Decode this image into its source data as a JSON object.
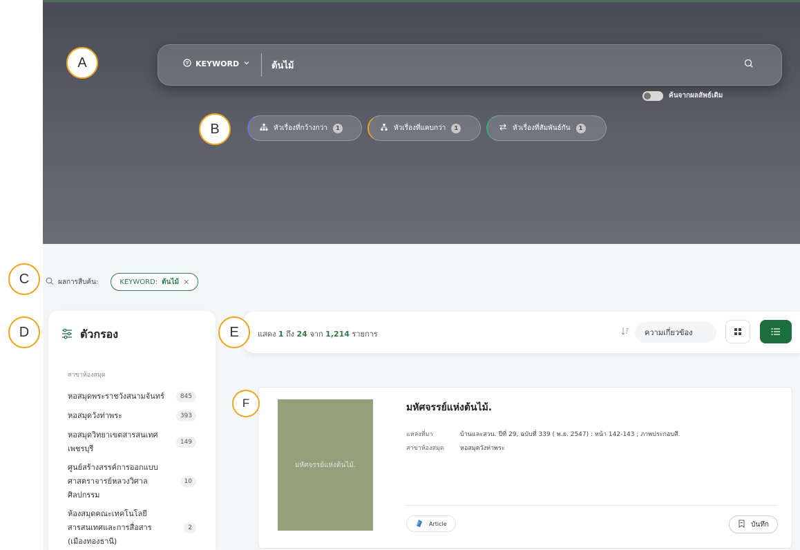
{
  "markers": {
    "a": "A",
    "b": "B",
    "c": "C",
    "d": "D",
    "e": "E",
    "f": "F"
  },
  "search": {
    "type_label": "KEYWORD",
    "value": "ต้นไม้",
    "toggle_label": "ค้นจากผลลัพธ์เดิม"
  },
  "related": [
    {
      "label": "หัวเรื่องที่กว้างกว่า",
      "count": "1",
      "accent": "#5b7be0"
    },
    {
      "label": "หัวเรื่องที่แคบกว่า",
      "count": "1",
      "accent": "#f0a521"
    },
    {
      "label": "หัวเรื่องที่สัมพันธ์กัน",
      "count": "1",
      "accent": "#3aaa7a"
    }
  ],
  "summary": {
    "label": "ผลการสืบค้น:",
    "chip_prefix": "KEYWORD:",
    "chip_value": "ต้นไม้"
  },
  "filter": {
    "title": "ตัวกรอง",
    "section": "สาขาห้องสมุด",
    "items": [
      {
        "label": "หอสมุดพระราชวังสนามจันทร์",
        "count": "845"
      },
      {
        "label": "หอสมุดวังท่าพระ",
        "count": "393"
      },
      {
        "label": "หอสมุดวิทยาเขตสารสนเทศเพชรบุรี",
        "count": "149"
      },
      {
        "label": "ศูนย์สร้างสรรค์การออกแบบศาสตราจารย์หลวงวิศาลศิลปกรรม",
        "count": "10"
      },
      {
        "label": "ห้องสมุดคณะเทคโนโลยีสารสนเทศและการสื่อสาร (เมืองทองธานี)",
        "count": "2"
      }
    ]
  },
  "toolbar": {
    "show_prefix": "แสดง",
    "from": "1",
    "to_word": "ถึง",
    "to": "24",
    "of_word": "จาก",
    "total": "1,214",
    "items_word": "รายการ",
    "sort_label": "ความเกี่ยวข้อง"
  },
  "result": {
    "title": "มหัศจรรย์แห่งต้นไม้.",
    "cover_text": "มหัศจรรย์แห่งต้นไม้.",
    "source_key": "แหล่งที่มา",
    "source_value": "บ้านและสวน. ปีที่ 29, ฉบับที่ 339 ( พ.ย. 2547) : หน้า 142-143 ; ภาพประกอบสี.",
    "branch_key": "สาขาห้องสมุด",
    "branch_value": "หอสมุดวังท่าพระ",
    "type": "Article",
    "save_label": "บันทึก"
  },
  "colors": {
    "accent_green": "#1f6e40",
    "marker_orange": "#f0a521",
    "cover": "#95a07a"
  }
}
